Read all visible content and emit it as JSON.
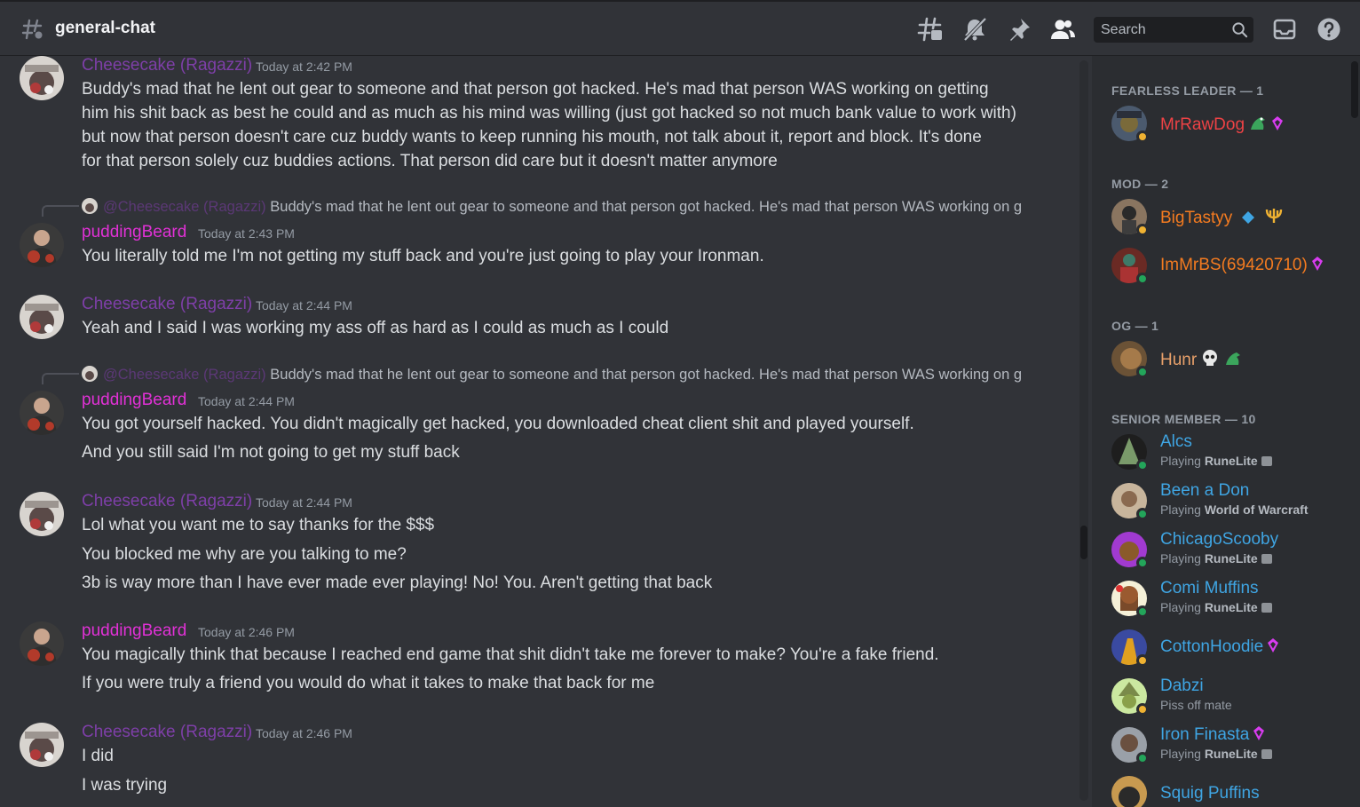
{
  "header": {
    "channel": "general-chat",
    "search_placeholder": "Search"
  },
  "colors": {
    "cheesecake": "#7e3fa8",
    "pudding": "#e131d6",
    "online": "#23a55a",
    "idle": "#f0b232"
  },
  "messages": [
    {
      "author": "Cheesecake (Ragazzi)",
      "time": "Today at 2:42 PM",
      "lines": [
        "Buddy's mad that he lent out gear to someone and that person got hacked. He's mad that person WAS working on getting",
        "him his shit back as best he could and as much as his mind was willing (just got hacked so not much bank value to work with)",
        "but now that person doesn't care cuz buddy wants to keep running his mouth, not talk about it, report and block. It's done",
        "for that person solely cuz buddies actions. That person did care but it doesn't matter anymore"
      ]
    },
    {
      "reply_author": "@Cheesecake (Ragazzi)",
      "reply_text": "Buddy's mad that he lent out gear to someone and that person got hacked. He's mad that person WAS working on g",
      "author": "puddingBeard",
      "time": "Today at 2:43 PM",
      "lines": [
        "You literally told me I'm not getting my stuff back and you're just going to play your Ironman."
      ]
    },
    {
      "author": "Cheesecake (Ragazzi)",
      "time": "Today at 2:44 PM",
      "lines": [
        "Yeah and I said I was working my ass off as hard as I could as much as I could"
      ]
    },
    {
      "reply_author": "@Cheesecake (Ragazzi)",
      "reply_text": "Buddy's mad that he lent out gear to someone and that person got hacked. He's mad that person WAS working on g",
      "author": "puddingBeard",
      "time": "Today at 2:44 PM",
      "lines": [
        "You got yourself hacked. You didn't magically get hacked, you downloaded cheat client shit and played yourself.",
        "And you still said I'm not going to get my stuff back"
      ]
    },
    {
      "author": "Cheesecake (Ragazzi)",
      "time": "Today at 2:44 PM",
      "lines": [
        "Lol what you want me to say thanks for the $$$",
        "You blocked me why are you talking to me?",
        "3b is way more than I have ever made ever playing! No! You. Aren't getting that back"
      ]
    },
    {
      "author": "puddingBeard",
      "time": "Today at 2:46 PM",
      "lines": [
        "You magically think that because I reached end game that shit didn't take me forever to make? You're a fake friend.",
        "If you were truly a friend you would do what it takes to make that back for me"
      ]
    },
    {
      "author": "Cheesecake (Ragazzi)",
      "time": "Today at 2:46 PM",
      "lines": [
        "I did",
        "I was trying"
      ]
    }
  ],
  "members": {
    "roles": [
      {
        "heading": "FEARLESS LEADER — 1"
      },
      {
        "heading": "MOD — 2"
      },
      {
        "heading": "OG — 1"
      },
      {
        "heading": "SENIOR MEMBER — 10"
      }
    ],
    "list": [
      {
        "name": "MrRawDog",
        "color": "#ed4245"
      },
      {
        "name": "BigTastyy",
        "color": "#f47b20"
      },
      {
        "name": "ImMrBS(69420710)",
        "color": "#f47b20"
      },
      {
        "name": "Hunr",
        "color": "#e8a06a"
      },
      {
        "name": "Alcs",
        "color": "#3fa5e3",
        "activity_prefix": "Playing",
        "activity": "RuneLite"
      },
      {
        "name": "Been a Don",
        "color": "#3fa5e3",
        "activity_prefix": "Playing",
        "activity": "World of Warcraft"
      },
      {
        "name": "ChicagoScooby",
        "color": "#3fa5e3",
        "activity_prefix": "Playing",
        "activity": "RuneLite"
      },
      {
        "name": "Comi Muffins",
        "color": "#3fa5e3",
        "activity_prefix": "Playing",
        "activity": "RuneLite"
      },
      {
        "name": "CottonHoodie",
        "color": "#3fa5e3"
      },
      {
        "name": "Dabzi",
        "color": "#3fa5e3",
        "status_text": "Piss off mate"
      },
      {
        "name": "Iron Finasta",
        "color": "#3fa5e3",
        "activity_prefix": "Playing",
        "activity": "RuneLite"
      },
      {
        "name": "Squig Puffins",
        "color": "#3fa5e3"
      }
    ]
  }
}
